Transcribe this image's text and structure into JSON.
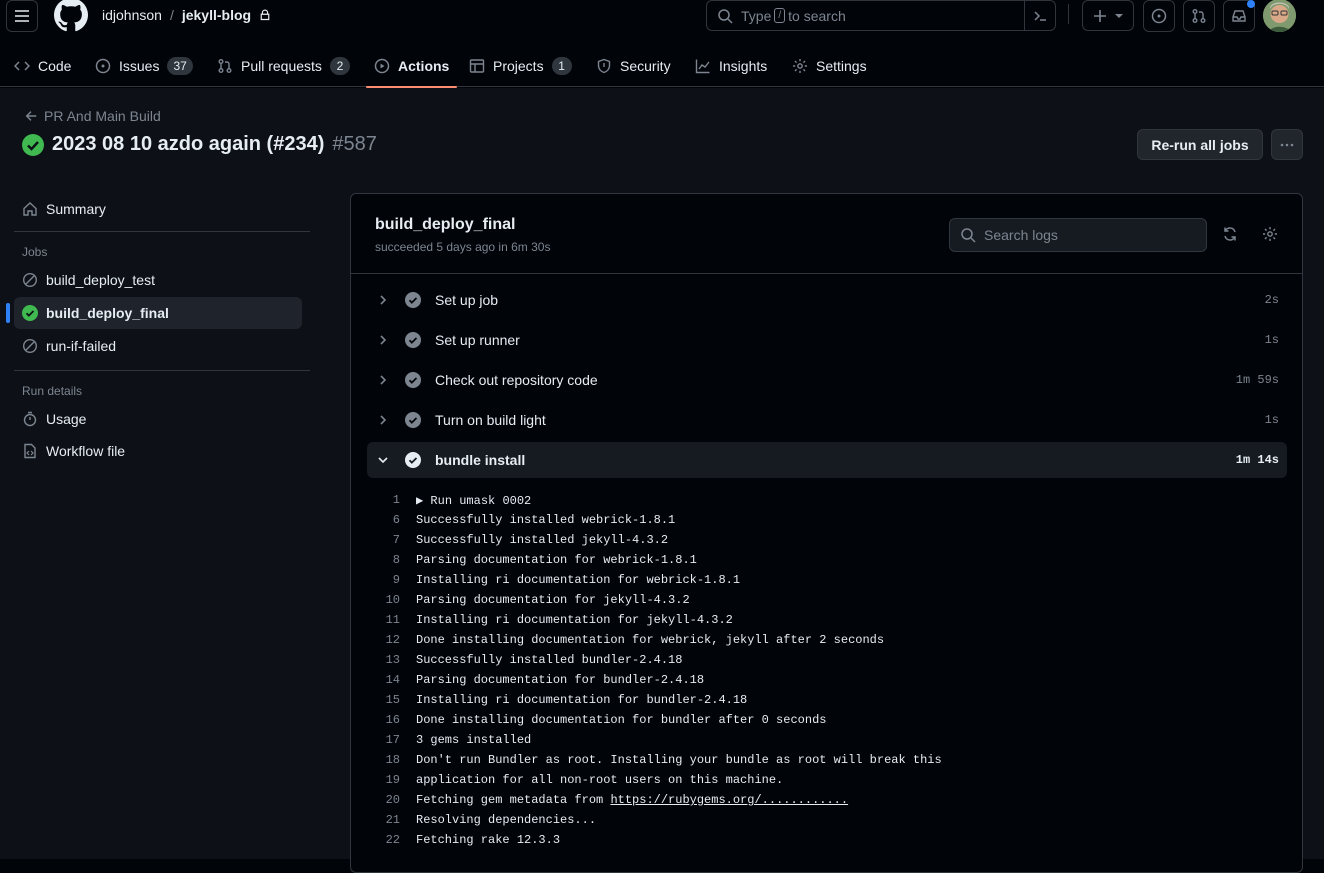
{
  "header": {
    "owner": "idjohnson",
    "separator": "/",
    "repo": "jekyll-blog",
    "search_prefix": "Type",
    "search_key": "/",
    "search_suffix": "to search"
  },
  "tabs": [
    {
      "label": "Code"
    },
    {
      "label": "Issues",
      "count": "37"
    },
    {
      "label": "Pull requests",
      "count": "2"
    },
    {
      "label": "Actions"
    },
    {
      "label": "Projects",
      "count": "1"
    },
    {
      "label": "Security"
    },
    {
      "label": "Insights"
    },
    {
      "label": "Settings"
    }
  ],
  "run": {
    "back_label": "PR And Main Build",
    "title": "2023 08 10 azdo again (#234)",
    "number": "#587",
    "rerun_label": "Re-run all jobs"
  },
  "sidebar": {
    "summary": "Summary",
    "jobs_heading": "Jobs",
    "jobs": [
      {
        "label": "build_deploy_test",
        "status": "skipped"
      },
      {
        "label": "build_deploy_final",
        "status": "success"
      },
      {
        "label": "run-if-failed",
        "status": "skipped"
      }
    ],
    "run_details_heading": "Run details",
    "usage": "Usage",
    "workflow_file": "Workflow file"
  },
  "job": {
    "name": "build_deploy_final",
    "status_text": "succeeded 5 days ago in 6m 30s",
    "search_placeholder": "Search logs"
  },
  "steps": [
    {
      "label": "Set up job",
      "duration": "2s"
    },
    {
      "label": "Set up runner",
      "duration": "1s"
    },
    {
      "label": "Check out repository code",
      "duration": "1m 59s"
    },
    {
      "label": "Turn on build light",
      "duration": "1s"
    },
    {
      "label": "bundle install",
      "duration": "1m 14s",
      "expanded": true
    }
  ],
  "log": [
    {
      "n": "1",
      "t": "▶ Run umask 0002"
    },
    {
      "n": "6",
      "t": "Successfully installed webrick-1.8.1"
    },
    {
      "n": "7",
      "t": "Successfully installed jekyll-4.3.2"
    },
    {
      "n": "8",
      "t": "Parsing documentation for webrick-1.8.1"
    },
    {
      "n": "9",
      "t": "Installing ri documentation for webrick-1.8.1"
    },
    {
      "n": "10",
      "t": "Parsing documentation for jekyll-4.3.2"
    },
    {
      "n": "11",
      "t": "Installing ri documentation for jekyll-4.3.2"
    },
    {
      "n": "12",
      "t": "Done installing documentation for webrick, jekyll after 2 seconds"
    },
    {
      "n": "13",
      "t": "Successfully installed bundler-2.4.18"
    },
    {
      "n": "14",
      "t": "Parsing documentation for bundler-2.4.18"
    },
    {
      "n": "15",
      "t": "Installing ri documentation for bundler-2.4.18"
    },
    {
      "n": "16",
      "t": "Done installing documentation for bundler after 0 seconds"
    },
    {
      "n": "17",
      "t": "3 gems installed"
    },
    {
      "n": "18",
      "t": "Don't run Bundler as root. Installing your bundle as root will break this"
    },
    {
      "n": "19",
      "t": "application for all non-root users on this machine."
    },
    {
      "n": "20",
      "t": "Fetching gem metadata from ",
      "link": "https://rubygems.org/............"
    },
    {
      "n": "21",
      "t": "Resolving dependencies..."
    },
    {
      "n": "22",
      "t": "Fetching rake 12.3.3"
    }
  ],
  "colors": {
    "accent": "#fd8c73",
    "success": "#3fb950",
    "link": "#2f81f7"
  }
}
